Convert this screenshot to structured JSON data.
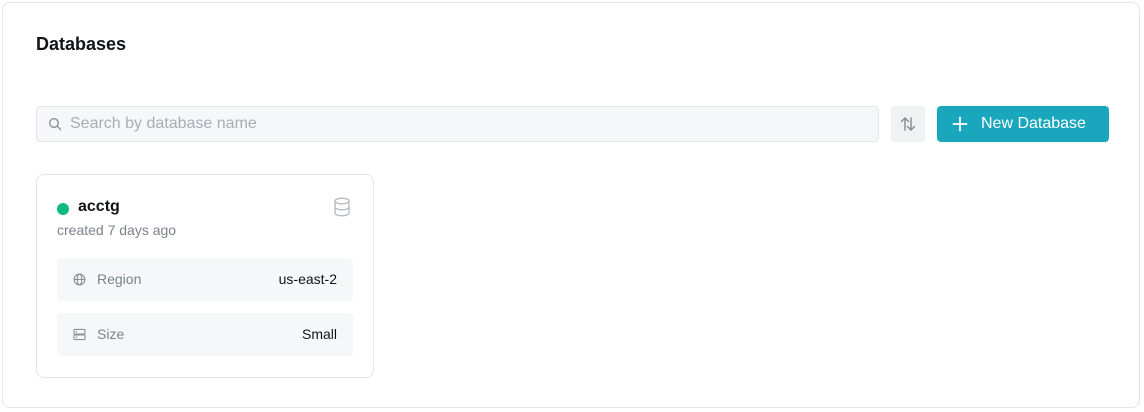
{
  "page": {
    "title": "Databases"
  },
  "toolbar": {
    "search_placeholder": "Search by database name",
    "search_value": "",
    "new_button_label": "New Database"
  },
  "colors": {
    "accent": "#1aa7bd",
    "status_active": "#10b981"
  },
  "databases": [
    {
      "name": "acctg",
      "created": "created 7 days ago",
      "status_icon": "status-dot-green",
      "properties": [
        {
          "icon": "globe-icon",
          "label": "Region",
          "value": "us-east-2"
        },
        {
          "icon": "server-icon",
          "label": "Size",
          "value": "Small"
        }
      ]
    }
  ]
}
